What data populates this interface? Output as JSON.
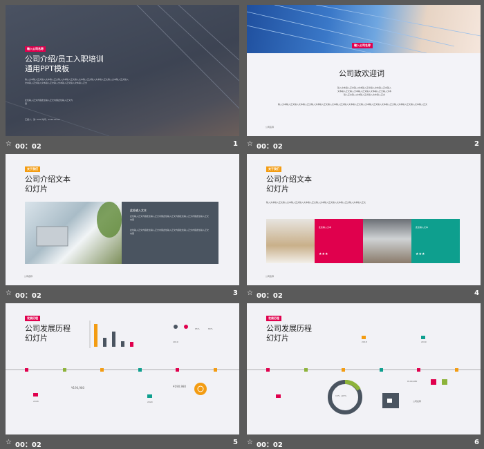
{
  "slides": [
    {
      "num": "1",
      "duration": "00：02",
      "tag": "输入公司名称",
      "title1": "公司介绍/员工入职培训",
      "title2": "通用PPT模板",
      "body": "输入文本输入正文输入文本输入正文输入文本输入正文输入文本输入正文输入文本输入正文输入文本输入正文输入文本输入正文输入文本输入正文输入文本输入正文输入文本输入正文",
      "sub": "此处输入正文内容此处输入正文内容此处输入正文内容",
      "footer": "汇报人：第一PPT  时间：2030.00.00"
    },
    {
      "num": "2",
      "duration": "00：02",
      "tag": "输入公司名称",
      "title": "公司致欢迎词",
      "body": "输入文本输入正文输入文本输入正文输入文本输入正文输入文本输入正文输入文本输入正文输入文本输入正文输入文本输入正文输入文本输入正文输入文本输入正文",
      "footer": "公司名称"
    },
    {
      "num": "3",
      "duration": "00：02",
      "tag": "关于我们",
      "title1": "公司介绍文本",
      "title2": "幻灯片",
      "box_title": "此处输入文本",
      "box_body": "此处输入正文内容此处输入正文内容此处输入正文内容此处输入正文内容此处输入正文内容",
      "footer": "公司名称"
    },
    {
      "num": "4",
      "duration": "00：02",
      "tag": "关于我们",
      "title1": "公司介绍文本",
      "title2": "幻灯片",
      "body": "输入文本输入正文输入文本输入正文输入文本输入正文输入文本输入正文输入文本输入正文输入文本输入正文",
      "card1": "此处输入文本",
      "card2": "此处输入文本",
      "footer": "公司名称"
    },
    {
      "num": "5",
      "duration": "00：02",
      "tag": "发展历程",
      "title1": "公司发展历程",
      "title2": "幻灯片",
      "pct1": "65%",
      "pct2": "80%",
      "money1": "¥190,980",
      "money2": "¥190,980",
      "year1": "2018",
      "year2": "2019",
      "year3": "2020"
    },
    {
      "num": "6",
      "duration": "00：02",
      "tag": "发展历程",
      "title1": "公司发展历程",
      "title2": "幻灯片",
      "ring": "15% | 20%",
      "year1": "2018",
      "year2": "2019",
      "money": "¥190,980",
      "footer": "公司名称"
    }
  ],
  "colors": {
    "pink": "#e0004d",
    "orange": "#f39c12",
    "teal": "#0e9f8e",
    "olive": "#8db33a",
    "dark": "#4a5460"
  }
}
